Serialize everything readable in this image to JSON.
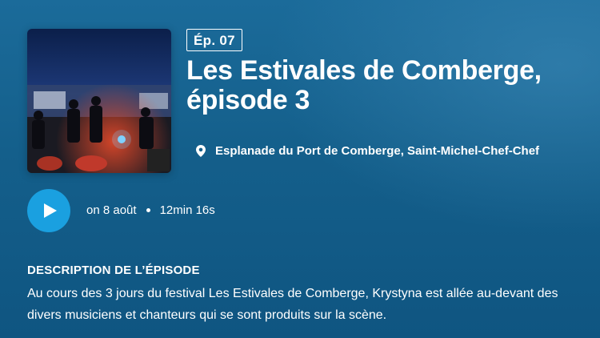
{
  "episode": {
    "badge": "Ép. 07",
    "title": "Les Estivales de Comberge, épisode 3",
    "location": "Esplanade du Port de Comberge, Saint-Michel-Chef-Chef",
    "date": "on 8 août",
    "duration": "12min 16s",
    "cover_alt": "Concert nocturne sur scène avec musiciens et public"
  },
  "description": {
    "heading": "DESCRIPTION DE L’ÉPISODE",
    "text": "Au cours des 3 jours du festival Les Estivales de Comberge, Krystyna est allée au-devant des divers musiciens et chanteurs qui se sont produits sur la scène."
  },
  "icons": {
    "location": "map-pin-icon",
    "play": "play-icon"
  },
  "colors": {
    "background": "#145f8b",
    "play_button": "#1aa0e0",
    "text": "#ffffff"
  }
}
